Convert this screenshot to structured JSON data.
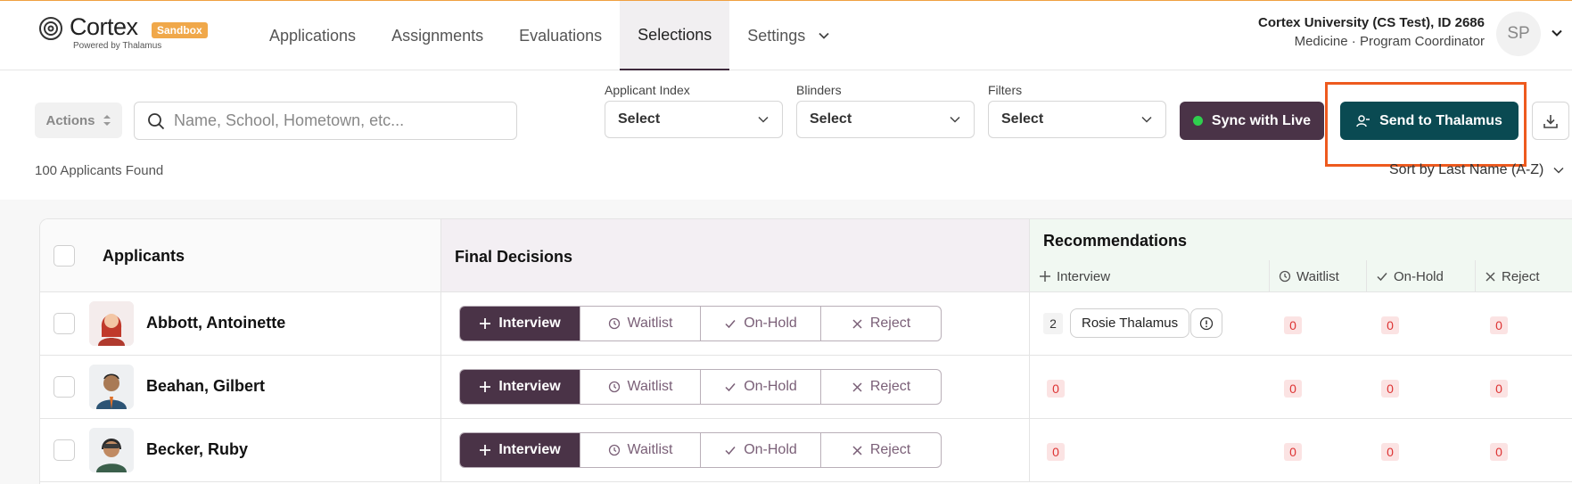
{
  "brand": {
    "name": "Cortex",
    "badge": "Sandbox",
    "tagline": "Powered by Thalamus"
  },
  "nav": [
    {
      "label": "Applications"
    },
    {
      "label": "Assignments"
    },
    {
      "label": "Evaluations"
    },
    {
      "label": "Selections",
      "active": true
    },
    {
      "label": "Settings"
    }
  ],
  "account": {
    "org": "Cortex University (CS Test), ID 2686",
    "role": "Medicine · Program Coordinator",
    "initials": "SP"
  },
  "toolbar": {
    "actions_label": "Actions",
    "search_placeholder": "Name, School, Hometown, etc...",
    "filters": [
      {
        "label": "Applicant Index",
        "value": "Select"
      },
      {
        "label": "Blinders",
        "value": "Select"
      },
      {
        "label": "Filters",
        "value": "Select"
      }
    ],
    "sync_label": "Sync with Live",
    "send_label": "Send to Thalamus"
  },
  "results": {
    "count_label": "100 Applicants Found",
    "sort_label": "Sort by Last Name (A-Z)"
  },
  "table": {
    "col_applicants": "Applicants",
    "col_final": "Final Decisions",
    "col_recommendations": "Recommendations",
    "rec_columns": [
      "Interview",
      "Waitlist",
      "On-Hold",
      "Reject"
    ],
    "decision_labels": [
      "Interview",
      "Waitlist",
      "On-Hold",
      "Reject"
    ],
    "rows": [
      {
        "name": "Abbott, Antoinette",
        "interview_count": "2",
        "interview_reviewer": "Rosie Thalamus",
        "waitlist": "0",
        "onhold": "0",
        "reject": "0"
      },
      {
        "name": "Beahan, Gilbert",
        "interview_count": "0",
        "waitlist": "0",
        "onhold": "0",
        "reject": "0"
      },
      {
        "name": "Becker, Ruby",
        "interview_count": "0",
        "waitlist": "0",
        "onhold": "0",
        "reject": "0"
      }
    ]
  },
  "colors": {
    "brand_plum": "#4a3347",
    "brand_teal": "#0a4a52",
    "highlight": "#ee5a1e",
    "badge": "#f0a84a"
  }
}
